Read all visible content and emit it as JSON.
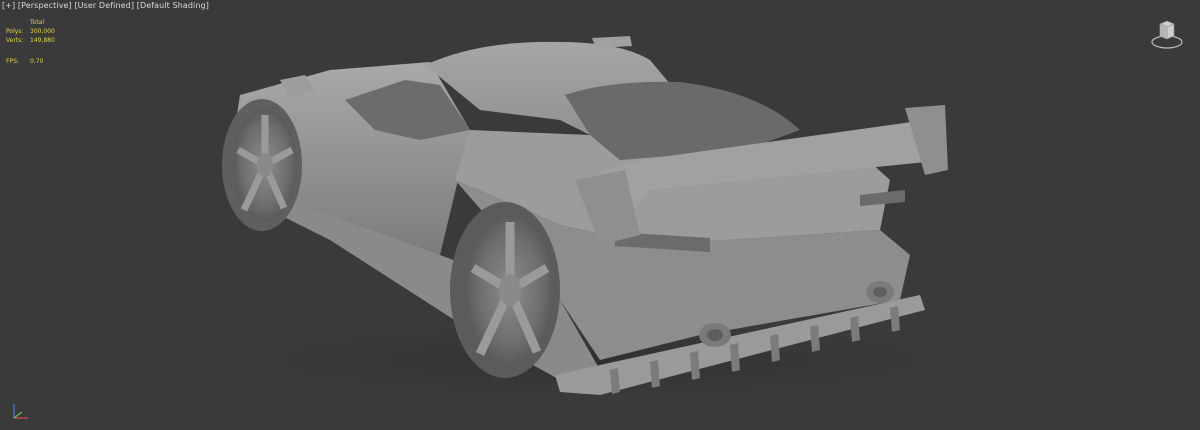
{
  "viewport": {
    "labels": [
      "[+]",
      "[Perspective]",
      "[User Defined]",
      "[Default Shading]"
    ]
  },
  "stats": {
    "header": "Total",
    "polys_label": "Polys:",
    "polys_value": "300,000",
    "verts_label": "Verts:",
    "verts_value": "149,880",
    "fps_label": "FPS:",
    "fps_value": "0.70"
  },
  "colors": {
    "background": "#3a3a3a",
    "stats_text": "#e6d24a",
    "label_text": "#dadada",
    "model_gray": "#9a9a9a"
  },
  "icons": [
    "viewcube-icon",
    "axis-gizmo-icon"
  ]
}
